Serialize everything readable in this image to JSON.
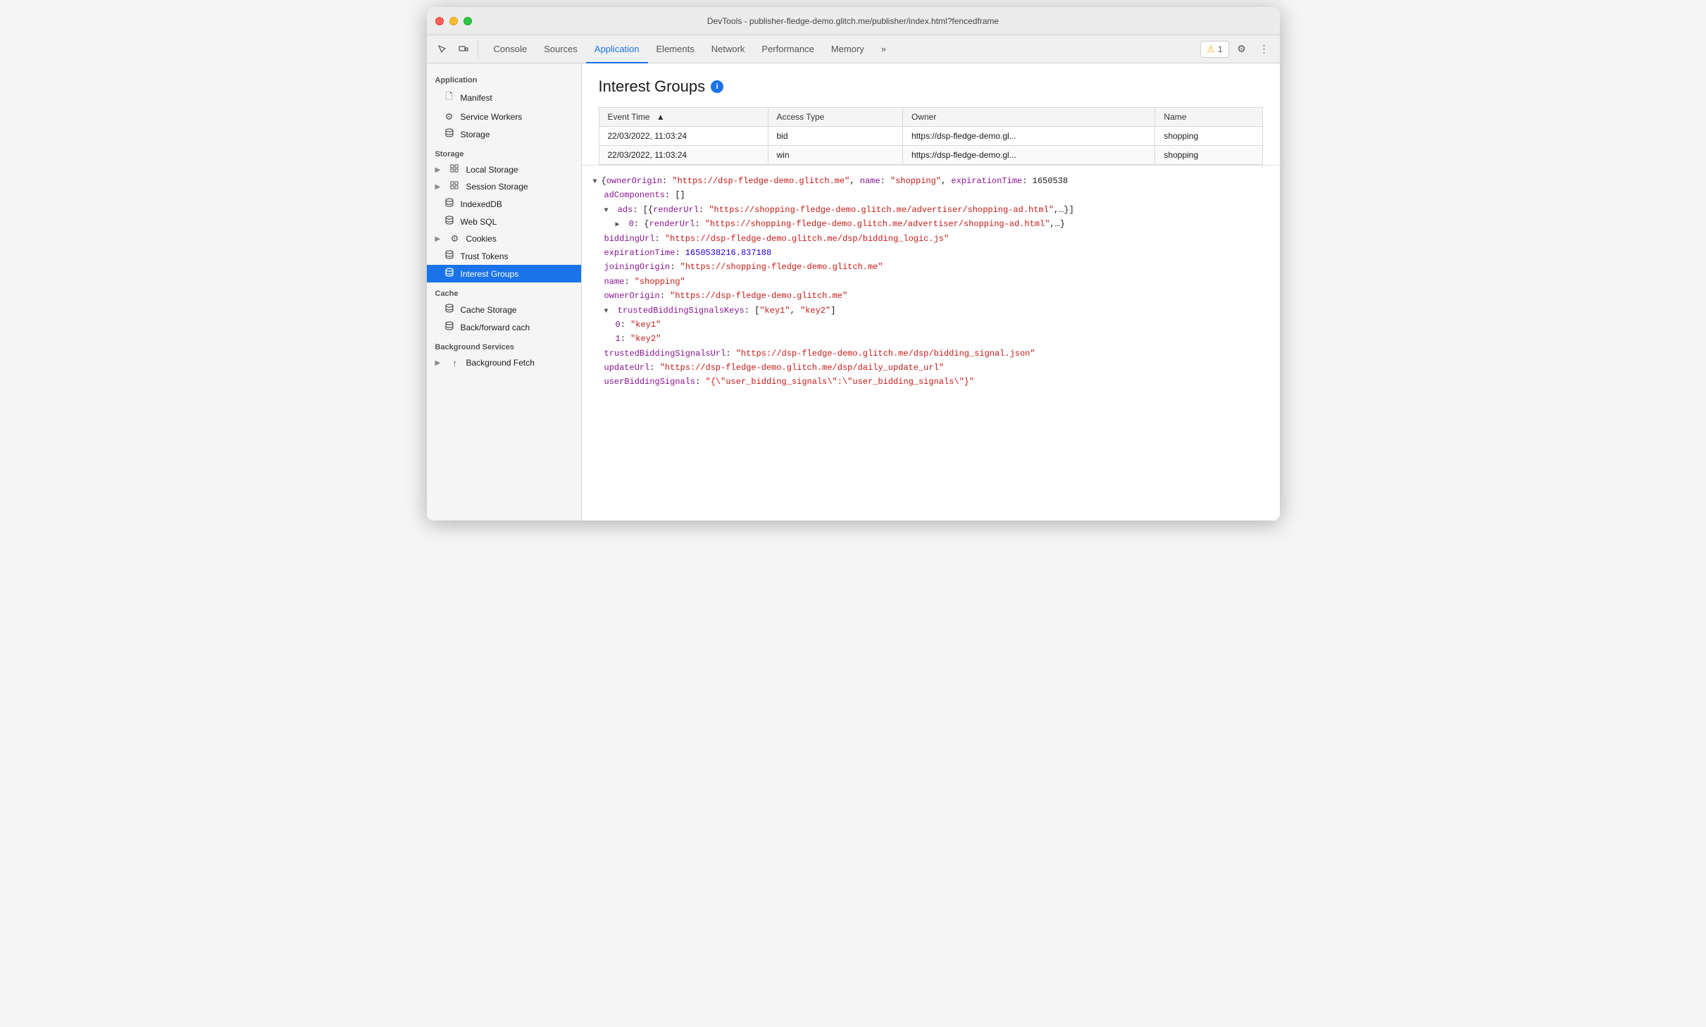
{
  "window": {
    "title": "DevTools - publisher-fledge-demo.glitch.me/publisher/index.html?fencedframe"
  },
  "toolbar": {
    "tabs": [
      {
        "id": "console",
        "label": "Console",
        "active": false
      },
      {
        "id": "sources",
        "label": "Sources",
        "active": false
      },
      {
        "id": "application",
        "label": "Application",
        "active": true
      },
      {
        "id": "elements",
        "label": "Elements",
        "active": false
      },
      {
        "id": "network",
        "label": "Network",
        "active": false
      },
      {
        "id": "performance",
        "label": "Performance",
        "active": false
      },
      {
        "id": "memory",
        "label": "Memory",
        "active": false
      }
    ],
    "more_tabs_label": "»",
    "warning_count": "1",
    "settings_icon": "⚙",
    "more_options_icon": "⋮"
  },
  "sidebar": {
    "sections": [
      {
        "id": "application",
        "header": "Application",
        "items": [
          {
            "id": "manifest",
            "label": "Manifest",
            "icon": "file",
            "active": false,
            "indent": true
          },
          {
            "id": "service-workers",
            "label": "Service Workers",
            "icon": "gear",
            "active": false,
            "indent": true
          },
          {
            "id": "storage",
            "label": "Storage",
            "icon": "db",
            "active": false,
            "indent": true
          }
        ]
      },
      {
        "id": "storage",
        "header": "Storage",
        "items": [
          {
            "id": "local-storage",
            "label": "Local Storage",
            "icon": "grid",
            "active": false,
            "indent": false,
            "hasArrow": true
          },
          {
            "id": "session-storage",
            "label": "Session Storage",
            "icon": "grid",
            "active": false,
            "indent": false,
            "hasArrow": true
          },
          {
            "id": "indexeddb",
            "label": "IndexedDB",
            "icon": "db",
            "active": false,
            "indent": true
          },
          {
            "id": "web-sql",
            "label": "Web SQL",
            "icon": "db",
            "active": false,
            "indent": true
          },
          {
            "id": "cookies",
            "label": "Cookies",
            "icon": "cookie",
            "active": false,
            "indent": false,
            "hasArrow": true
          },
          {
            "id": "trust-tokens",
            "label": "Trust Tokens",
            "icon": "db",
            "active": false,
            "indent": true
          },
          {
            "id": "interest-groups",
            "label": "Interest Groups",
            "icon": "db",
            "active": true,
            "indent": true
          }
        ]
      },
      {
        "id": "cache",
        "header": "Cache",
        "items": [
          {
            "id": "cache-storage",
            "label": "Cache Storage",
            "icon": "db",
            "active": false,
            "indent": true
          },
          {
            "id": "back-forward-cache",
            "label": "Back/forward cach",
            "icon": "db",
            "active": false,
            "indent": true
          }
        ]
      },
      {
        "id": "background-services",
        "header": "Background Services",
        "items": [
          {
            "id": "background-fetch",
            "label": "Background Fetch",
            "icon": "upload",
            "active": false,
            "indent": false,
            "hasArrow": true
          }
        ]
      }
    ]
  },
  "interest_groups": {
    "title": "Interest Groups",
    "table": {
      "columns": [
        {
          "id": "event-time",
          "label": "Event Time",
          "sortable": true
        },
        {
          "id": "access-type",
          "label": "Access Type"
        },
        {
          "id": "owner",
          "label": "Owner"
        },
        {
          "id": "name",
          "label": "Name"
        }
      ],
      "rows": [
        {
          "event_time": "22/03/2022, 11:03:24",
          "access_type": "bid",
          "owner": "https://dsp-fledge-demo.gl...",
          "name": "shopping"
        },
        {
          "event_time": "22/03/2022, 11:03:24",
          "access_type": "win",
          "owner": "https://dsp-fledge-demo.gl...",
          "name": "shopping"
        }
      ]
    }
  },
  "json_detail": {
    "lines": [
      {
        "type": "root",
        "text": "{ownerOrigin: \"https://dsp-fledge-demo.glitch.me\", name: \"shopping\", expirationTime: 1650538",
        "hasTriangle": true,
        "triangleDir": "down",
        "indent": 0
      },
      {
        "type": "key-value",
        "key": "adComponents",
        "value": "[]",
        "indent": 2
      },
      {
        "type": "key-array",
        "key": "ads",
        "value": "[{renderUrl: \"https://shopping-fledge-demo.glitch.me/advertiser/shopping-ad.html\",…}]",
        "indent": 2,
        "hasTriangle": true,
        "triangleDir": "down"
      },
      {
        "type": "key-object",
        "key": "0",
        "value": "{renderUrl: \"https://shopping-fledge-demo.glitch.me/advertiser/shopping-ad.html\",…}",
        "indent": 4,
        "hasTriangle": true,
        "triangleDir": "right"
      },
      {
        "type": "key-string",
        "key": "biddingUrl",
        "value": "\"https://dsp-fledge-demo.glitch.me/dsp/bidding_logic.js\"",
        "indent": 2
      },
      {
        "type": "key-number",
        "key": "expirationTime",
        "value": "1650538216.837188",
        "indent": 2
      },
      {
        "type": "key-string",
        "key": "joiningOrigin",
        "value": "\"https://shopping-fledge-demo.glitch.me\"",
        "indent": 2
      },
      {
        "type": "key-string",
        "key": "name",
        "value": "\"shopping\"",
        "indent": 2
      },
      {
        "type": "key-string",
        "key": "ownerOrigin",
        "value": "\"https://dsp-fledge-demo.glitch.me\"",
        "indent": 2
      },
      {
        "type": "key-array",
        "key": "trustedBiddingSignalsKeys",
        "value": "[\"key1\", \"key2\"]",
        "indent": 2,
        "hasTriangle": true,
        "triangleDir": "down"
      },
      {
        "type": "key-string",
        "key": "0",
        "value": "\"key1\"",
        "indent": 4
      },
      {
        "type": "key-string",
        "key": "1",
        "value": "\"key2\"",
        "indent": 4
      },
      {
        "type": "key-string",
        "key": "trustedBiddingSignalsUrl",
        "value": "\"https://dsp-fledge-demo.glitch.me/dsp/bidding_signal.json\"",
        "indent": 2
      },
      {
        "type": "key-string",
        "key": "updateUrl",
        "value": "\"https://dsp-fledge-demo.glitch.me/dsp/daily_update_url\"",
        "indent": 2
      },
      {
        "type": "key-string",
        "key": "userBiddingSignals",
        "value": "\"{\\\"user_bidding_signals\\\":\\\"user_bidding_signals\\\"}\"",
        "indent": 2
      }
    ]
  }
}
